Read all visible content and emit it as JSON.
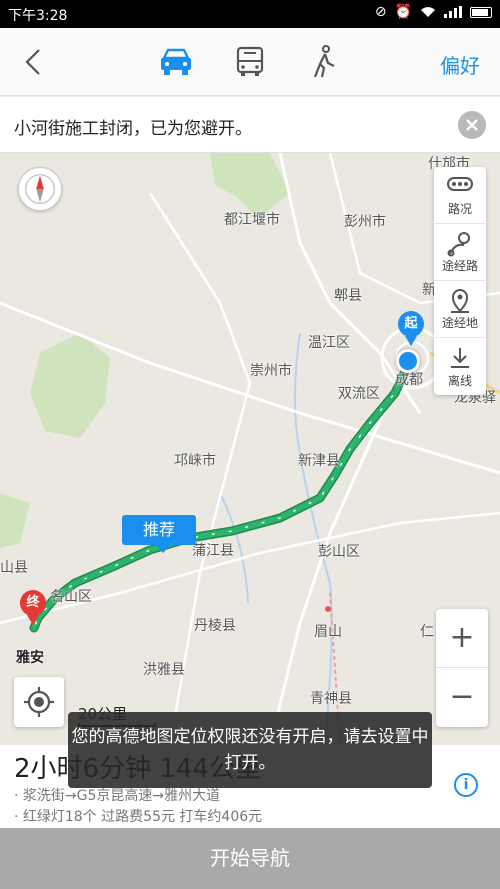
{
  "status_bar": {
    "time": "下午3:28"
  },
  "top_nav": {
    "preference_label": "偏好"
  },
  "notice": {
    "text": "小河街施工封闭，已为您避开。"
  },
  "map": {
    "tools": [
      {
        "label": "路况",
        "icon": "traffic-icon"
      },
      {
        "label": "途经路",
        "icon": "via-road-icon"
      },
      {
        "label": "途经地",
        "icon": "via-place-icon"
      },
      {
        "label": "离线",
        "icon": "offline-download-icon"
      }
    ],
    "places": [
      {
        "name": "什邡市"
      },
      {
        "name": "都江堰市"
      },
      {
        "name": "彭州市"
      },
      {
        "name": "郫县"
      },
      {
        "name": "新"
      },
      {
        "name": "温江区"
      },
      {
        "name": "崇州市"
      },
      {
        "name": "双流区"
      },
      {
        "name": "成都"
      },
      {
        "name": "龙泉驿"
      },
      {
        "name": "邛崃市"
      },
      {
        "name": "新津县"
      },
      {
        "name": "蒲江县"
      },
      {
        "name": "彭山区"
      },
      {
        "name": "山县"
      },
      {
        "name": "名山区"
      },
      {
        "name": "丹棱县"
      },
      {
        "name": "眉山"
      },
      {
        "name": "仁"
      },
      {
        "name": "洪雅县"
      },
      {
        "name": "青神县"
      }
    ],
    "start_marker": "起",
    "end_marker": "终",
    "end_city": "雅安",
    "recommend_tag": "推荐",
    "scale_label": "20公里",
    "zoom_in": "+",
    "zoom_out": "−",
    "route_color": "#2db36b",
    "accent_color": "#1a8ff0"
  },
  "summary": {
    "duration_distance": "2小时6分钟  144公里",
    "roads": "· 浆洗街→G5京昆高速→雅州大道",
    "costs": "· 红绿灯18个   过路费55元   打车约406元",
    "info_icon": "i"
  },
  "toast": {
    "text": "您的高德地图定位权限还没有开启，请去设置中打开。"
  },
  "start_button": {
    "label": "开始导航"
  }
}
